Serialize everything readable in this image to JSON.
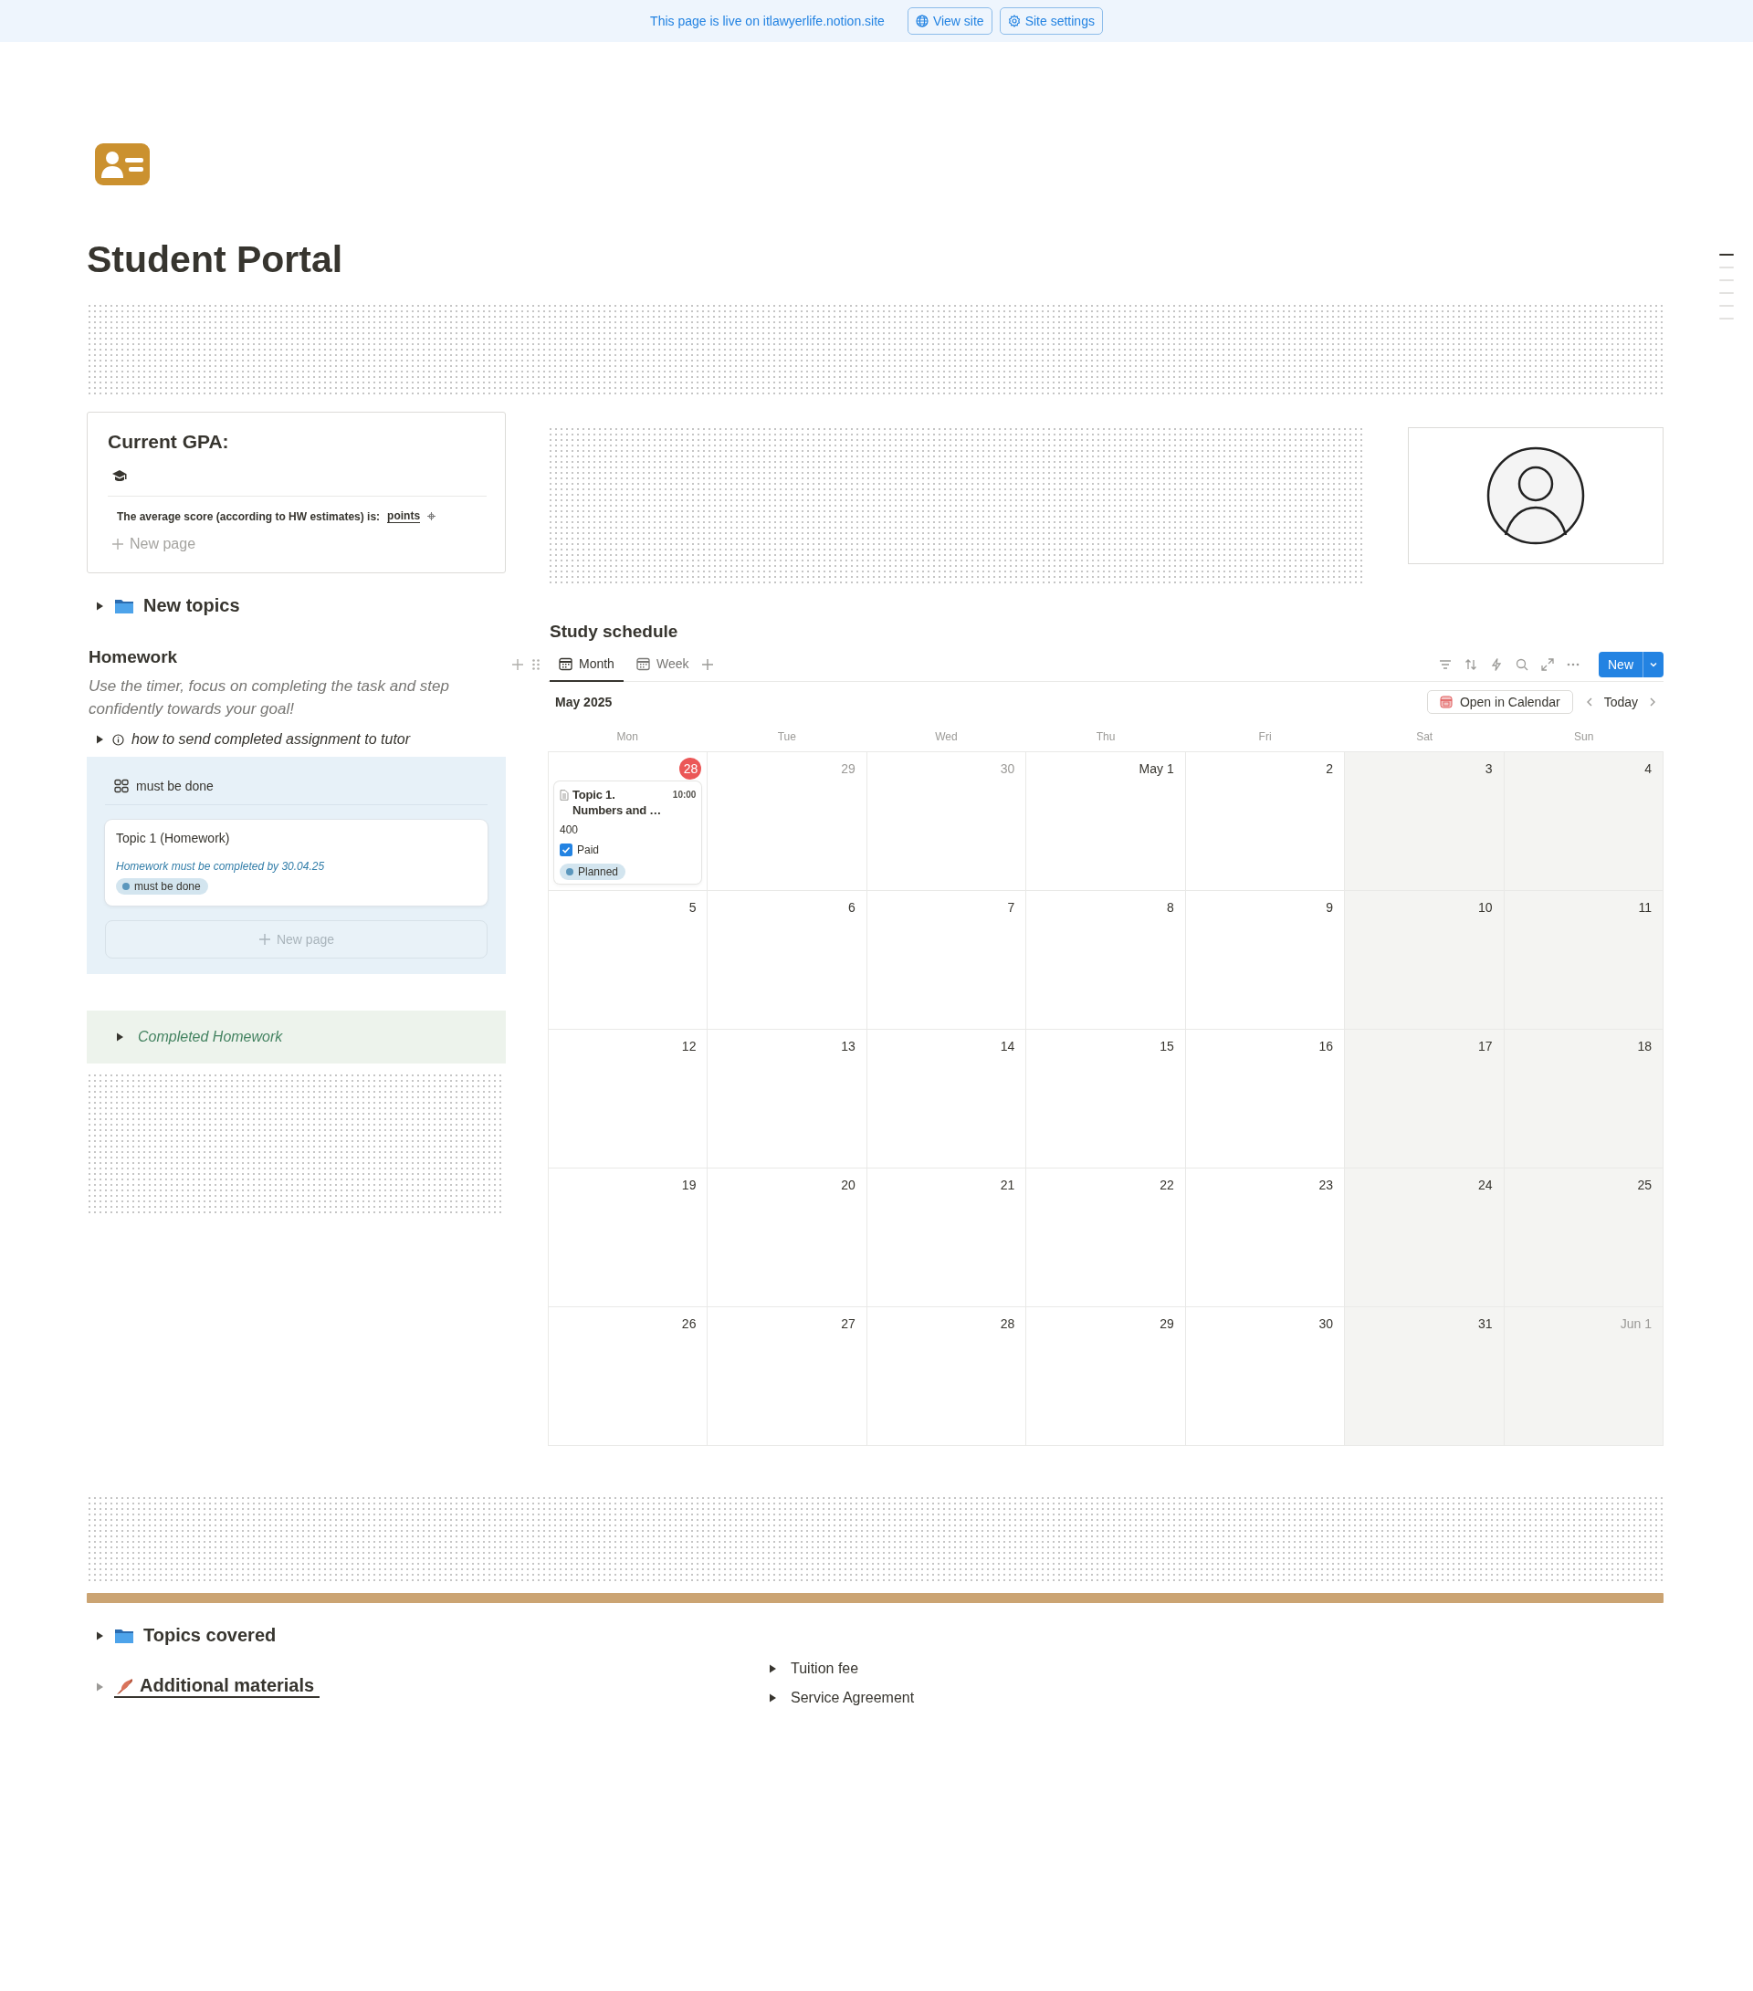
{
  "banner": {
    "text": "This page is live on itlawyerlife.notion.site",
    "buttons": [
      {
        "kind": "globe",
        "label": "View site"
      },
      {
        "kind": "gear",
        "label": "Site settings"
      }
    ]
  },
  "page": {
    "title": "Student Portal"
  },
  "outline_markers": [
    {
      "selected": true
    },
    {
      "selected": false
    },
    {
      "selected": false
    },
    {
      "selected": false
    },
    {
      "selected": false
    },
    {
      "selected": false
    }
  ],
  "gpa": {
    "title": "Current GPA:",
    "row_text": "The average score (according to HW estimates) is:",
    "row_link": "points",
    "new_page": "New page"
  },
  "new_topics": {
    "title": "New topics",
    "expanded": false
  },
  "homework": {
    "title": "Homework",
    "description": "Use the timer, focus on completing the task and step confidently towards your goal!",
    "toggle": {
      "text": "how to send completed assignment to tutor",
      "expanded": false
    },
    "board": {
      "group": "must be done",
      "cards": [
        {
          "title": "Topic 1 (Homework)",
          "note": "Homework must be completed by 30.04.25",
          "tag": "must be done"
        }
      ],
      "new_page": "New page"
    },
    "completed": {
      "title": "Completed Homework",
      "expanded": false
    }
  },
  "schedule": {
    "title": "Study schedule",
    "tabs": [
      {
        "label": "Month",
        "selected": true
      },
      {
        "label": "Week",
        "selected": false
      }
    ],
    "new_button": "New",
    "month": "May 2025",
    "open_calendar": "Open in Calendar",
    "today_button": "Today",
    "weekdays": [
      "Mon",
      "Tue",
      "Wed",
      "Thu",
      "Fri",
      "Sat",
      "Sun"
    ],
    "weeks": [
      [
        {
          "label": "28",
          "muted": false,
          "today": true,
          "events": [
            {
              "title": "Topic 1. Numbers and …",
              "time": "10:00",
              "amount": "400",
              "paid_label": "Paid",
              "paid": true,
              "status": "Planned"
            }
          ]
        },
        {
          "label": "29",
          "muted": true,
          "today": false
        },
        {
          "label": "30",
          "muted": true,
          "today": false
        },
        {
          "label": "May 1",
          "muted": false,
          "today": false
        },
        {
          "label": "2",
          "muted": false,
          "today": false
        },
        {
          "label": "3",
          "muted": false,
          "today": false
        },
        {
          "label": "4",
          "muted": false,
          "today": false
        }
      ],
      [
        {
          "label": "5",
          "muted": false,
          "today": false
        },
        {
          "label": "6",
          "muted": false,
          "today": false
        },
        {
          "label": "7",
          "muted": false,
          "today": false
        },
        {
          "label": "8",
          "muted": false,
          "today": false
        },
        {
          "label": "9",
          "muted": false,
          "today": false
        },
        {
          "label": "10",
          "muted": false,
          "today": false
        },
        {
          "label": "11",
          "muted": false,
          "today": false
        }
      ],
      [
        {
          "label": "12",
          "muted": false,
          "today": false
        },
        {
          "label": "13",
          "muted": false,
          "today": false
        },
        {
          "label": "14",
          "muted": false,
          "today": false
        },
        {
          "label": "15",
          "muted": false,
          "today": false
        },
        {
          "label": "16",
          "muted": false,
          "today": false
        },
        {
          "label": "17",
          "muted": false,
          "today": false
        },
        {
          "label": "18",
          "muted": false,
          "today": false
        }
      ],
      [
        {
          "label": "19",
          "muted": false,
          "today": false
        },
        {
          "label": "20",
          "muted": false,
          "today": false
        },
        {
          "label": "21",
          "muted": false,
          "today": false
        },
        {
          "label": "22",
          "muted": false,
          "today": false
        },
        {
          "label": "23",
          "muted": false,
          "today": false
        },
        {
          "label": "24",
          "muted": false,
          "today": false
        },
        {
          "label": "25",
          "muted": false,
          "today": false
        }
      ],
      [
        {
          "label": "26",
          "muted": false,
          "today": false
        },
        {
          "label": "27",
          "muted": false,
          "today": false
        },
        {
          "label": "28",
          "muted": false,
          "today": false
        },
        {
          "label": "29",
          "muted": false,
          "today": false
        },
        {
          "label": "30",
          "muted": false,
          "today": false
        },
        {
          "label": "31",
          "muted": false,
          "today": false
        },
        {
          "label": "Jun 1",
          "muted": true,
          "today": false
        }
      ]
    ]
  },
  "bottom": {
    "topics_covered": {
      "title": "Topics covered",
      "expanded": false
    },
    "additional": {
      "title": "Additional materials",
      "expanded": false
    },
    "toggles": [
      {
        "text": "Tuition fee",
        "expanded": false
      },
      {
        "text": "Service Agreement",
        "expanded": false
      }
    ]
  }
}
